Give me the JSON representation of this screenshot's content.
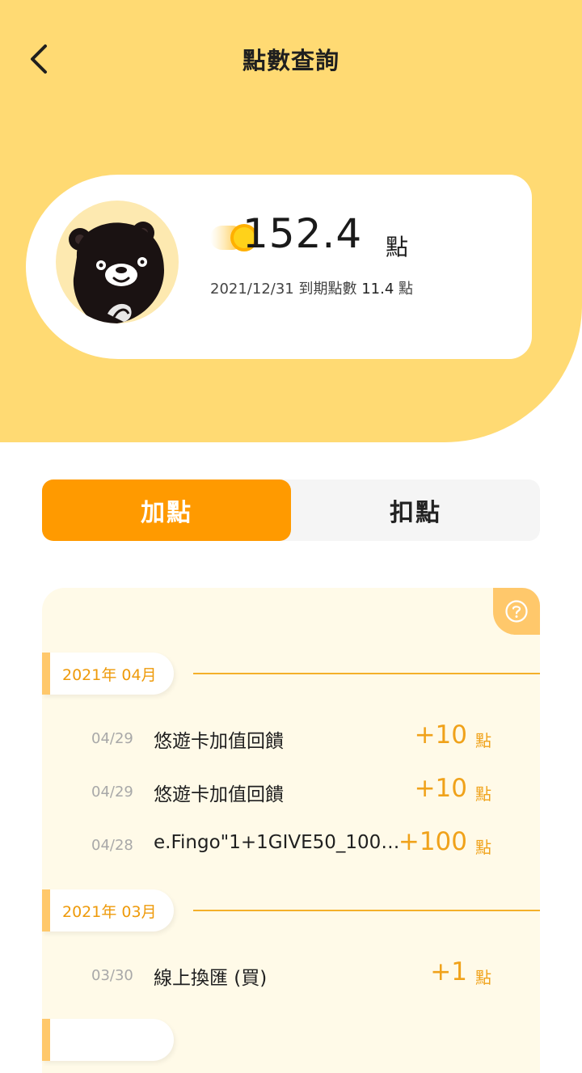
{
  "header": {
    "title": "點數查詢",
    "colors": {
      "hero_bg": "#ffda73",
      "accent": "#ff9a00"
    }
  },
  "summary": {
    "points": "152.4",
    "unit": "點",
    "expiry_date": "2021/12/31",
    "expiry_label": "到期點數",
    "expiry_points": "11.4",
    "expiry_unit": "點",
    "avatar_icon": "bear-mascot-icon",
    "coin_icon": "coin-icon"
  },
  "tabs": [
    {
      "label": "加點",
      "active": true
    },
    {
      "label": "扣點",
      "active": false
    }
  ],
  "history": {
    "help_icon": "question-circle-icon",
    "groups": [
      {
        "month": "2021年 04月",
        "items": [
          {
            "date": "04/29",
            "desc": "悠遊卡加值回饋",
            "amount": "+10",
            "unit": "點"
          },
          {
            "date": "04/29",
            "desc": "悠遊卡加值回饋",
            "amount": "+10",
            "unit": "點"
          },
          {
            "date": "04/28",
            "desc": "e.Fingo\"1+1GIVE50_100\"...",
            "amount": "+100",
            "unit": "點"
          }
        ]
      },
      {
        "month": "2021年 03月",
        "items": [
          {
            "date": "03/30",
            "desc": "線上換匯 (買)",
            "amount": "+1",
            "unit": "點"
          }
        ]
      }
    ]
  }
}
